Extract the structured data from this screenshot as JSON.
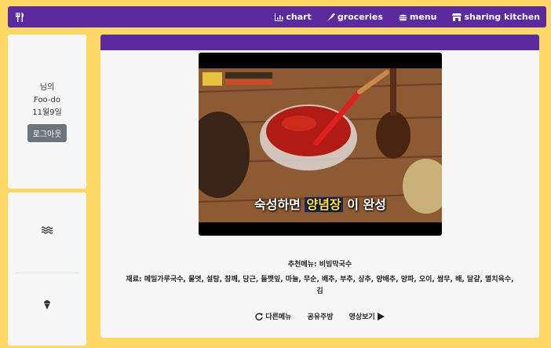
{
  "nav": {
    "brand_icon": "utensils-icon",
    "links": [
      {
        "label": "chart",
        "icon": "chart-icon"
      },
      {
        "label": "groceries",
        "icon": "carrot-icon"
      },
      {
        "label": "menu",
        "icon": "hamburger-icon"
      },
      {
        "label": "sharing kitchen",
        "icon": "store-icon"
      }
    ]
  },
  "user": {
    "name_suffix": "님의",
    "app_name": "Foo-do",
    "date": "11월9일",
    "logout_label": "로그아웃"
  },
  "side": {
    "icons": [
      "water-icon",
      "ice-cream-icon"
    ]
  },
  "video": {
    "caption_pre": "숙성하면",
    "caption_highlight": "양념장",
    "caption_post": "이 완성"
  },
  "recipe": {
    "menu_label": "추천메뉴: 비빔막국수",
    "ingredients": "재료: 메밀가루국수, 물엿, 설탕, 참깨, 당근, 들깻잎, 마늘, 무순, 배추, 부추, 상추, 양배추, 양파, 오이, 쌈무, 배, 달걀, 멸치육수, 김"
  },
  "actions": {
    "other_menu": "다른메뉴",
    "shared_kitchen": "공유주방",
    "watch_video": "영상보기"
  },
  "colors": {
    "accent": "#5b2a9e",
    "background": "#ffd866",
    "card": "#f7f7f7"
  }
}
